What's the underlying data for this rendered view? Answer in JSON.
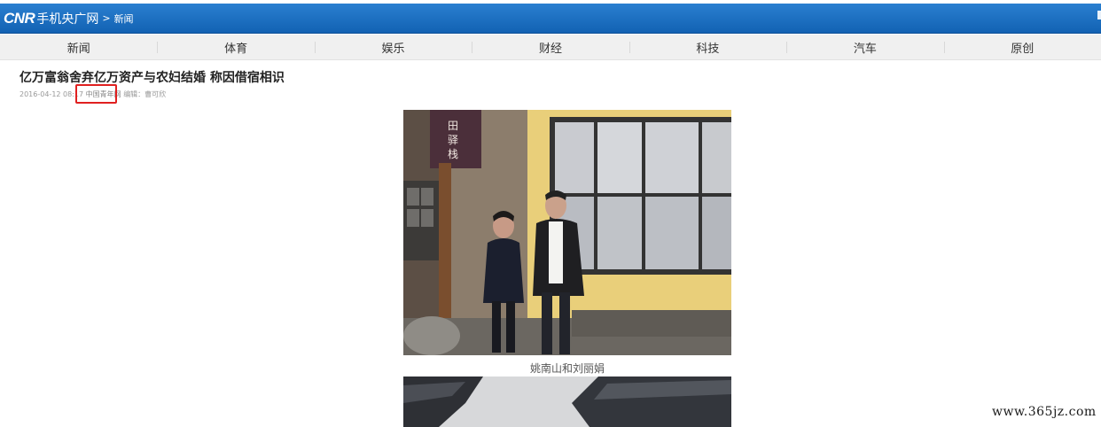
{
  "header": {
    "logo": "CNR",
    "site_name": "手机央广网",
    "breadcrumb_sep": ">",
    "breadcrumb": "新闻"
  },
  "nav": {
    "items": [
      "新闻",
      "体育",
      "娱乐",
      "财经",
      "科技",
      "汽车",
      "原创"
    ]
  },
  "article": {
    "title": "亿万富翁舍弃亿万资产与农妇结婚 称因借宿相识",
    "date": "2016-04-12 08:17",
    "source": "中国青年网",
    "editor": "编辑：曹可欣",
    "photo1_sign_text": "田驿栈",
    "photo1_caption": "姚南山和刘丽娟"
  },
  "watermark": "www.365jz.com",
  "colors": {
    "header_blue": "#1a6fc1",
    "nav_bg": "#f0f0f0",
    "highlight_red": "#e02020"
  }
}
